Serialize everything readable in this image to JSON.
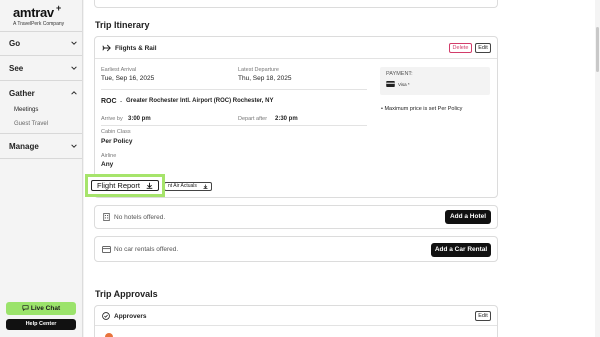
{
  "brand": {
    "name": "amtrav",
    "plus": "+",
    "tagline": "A TravelPerk Company"
  },
  "nav": {
    "go": "Go",
    "see": "See",
    "gather": "Gather",
    "meetings": "Meetings",
    "guest_travel": "Guest Travel",
    "manage": "Manage"
  },
  "support": {
    "live_chat": "Live Chat",
    "help_center": "Help Center"
  },
  "itinerary": {
    "title": "Trip Itinerary",
    "flights_label": "Flights & Rail",
    "delete": "Delete",
    "edit": "Edit",
    "earliest_arrival_label": "Earliest Arrival",
    "earliest_arrival_value": "Tue, Sep 16, 2025",
    "latest_departure_label": "Latest Departure",
    "latest_departure_value": "Thu, Sep 18, 2025",
    "airport_code": "ROC",
    "airport_dash": "-",
    "airport_name": "Greater Rochester Intl. Airport (ROC) Rochester, NY",
    "arrive_by_label": "Arrive by",
    "arrive_by_value": "3:00 pm",
    "depart_after_label": "Depart after",
    "depart_after_value": "2:30 pm",
    "cabin_class_label": "Cabin Class",
    "cabin_class_value": "Per Policy",
    "airline_label": "Airline",
    "airline_value": "Any",
    "payment_label": "PAYMENT:",
    "payment_card": "Visa *",
    "policy_note": "Maximum price is set Per Policy",
    "flight_report": "Flight Report",
    "print_air_actuals": "nt Air Actuals"
  },
  "hotels": {
    "empty": "No hotels offered.",
    "add": "Add a Hotel"
  },
  "cars": {
    "empty": "No car rentals offered.",
    "add": "Add a Car Rental"
  },
  "approvals": {
    "title": "Trip Approvals",
    "approvers": "Approvers",
    "edit": "Edit"
  }
}
